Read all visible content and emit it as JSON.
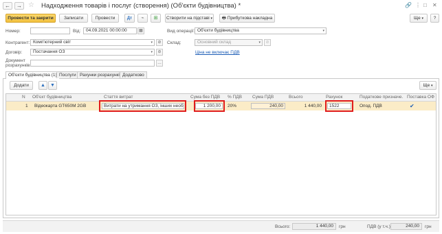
{
  "window": {
    "title": "Надходження товарів і послуг (створення) (Об'єкти будівництва) *",
    "back_label": "←",
    "forward_label": "→",
    "star_label": "☆",
    "link_icon": "🔗",
    "menu_icon": "⋮",
    "maximize_icon": "□",
    "close_icon": "✕"
  },
  "toolbar": {
    "post_close": "Провести та закрити",
    "save": "Записати",
    "post": "Провести",
    "create_basis": "Створити на підставі",
    "receipt_invoice": "Прибуткова накладна",
    "more": "Ще",
    "help": "?"
  },
  "form": {
    "number_label": "Номер:",
    "number_value": "",
    "date_label": "Від:",
    "date_value": "04.09.2021 00:00:00",
    "operation_label": "Вид операції:",
    "operation_value": "Об'єкти будівництва",
    "counterparty_label": "Контрагент:",
    "counterparty_value": "Комп'ютерний світ",
    "warehouse_label": "Склад:",
    "warehouse_value": "Основний склад",
    "contract_label": "Договір:",
    "contract_value": "Постачання ОЗ",
    "vat_link": "Ціна не включає ПДВ",
    "settlement_label_1": "Документ",
    "settlement_label_2": "розрахунків:",
    "settlement_value": ""
  },
  "tabs": [
    {
      "label": "Об'єкти будівництва (1)"
    },
    {
      "label": "Послуги"
    },
    {
      "label": "Рахунки розрахунків"
    },
    {
      "label": "Додатково"
    }
  ],
  "grid_toolbar": {
    "add": "Додати",
    "up_icon": "arrow-up-icon",
    "down_icon": "arrow-down-icon",
    "more": "Ще"
  },
  "grid": {
    "columns": [
      "N",
      "Об'єкт будівництва",
      "Стаття витрат",
      "Сума без ПДВ",
      "% ПДВ",
      "Сума ПДВ",
      "Всього",
      "Рахунок",
      "Податкове призначе...",
      "Поставка ОФ"
    ],
    "rows": [
      {
        "n": "1",
        "object": "Відеокарта GT650M 2GB",
        "expense": "Витрати на утримання ОЗ, інших необор",
        "amount": "1 200,00",
        "vat_rate": "20%",
        "vat_amount": "240,00",
        "total": "1 440,00",
        "account": "1522",
        "tax_purpose": "Опод. ПДВ",
        "delivery": "✔"
      }
    ]
  },
  "footer": {
    "total_label": "Всього:",
    "total_value": "1 440,00",
    "total_currency": "грн",
    "vat_label": "ПДВ (у т.ч.):",
    "vat_value": "240,00",
    "vat_currency": "грн"
  },
  "colors": {
    "primary_button": "#f2c13f",
    "selected_row": "#fbecc7",
    "highlight_box": "#e01b1b",
    "link": "#1a5bb5"
  }
}
